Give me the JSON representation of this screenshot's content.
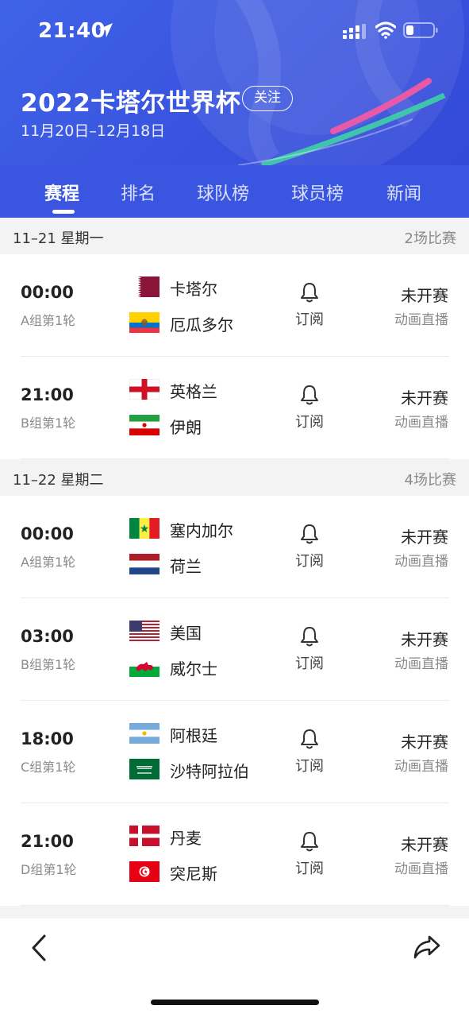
{
  "status_bar": {
    "time": "21:40"
  },
  "header": {
    "title": "2022卡塔尔世界杯",
    "follow_label": "关注",
    "dates": "11月20日–12月18日"
  },
  "tabs": [
    {
      "label": "赛程",
      "active": true
    },
    {
      "label": "排名",
      "active": false
    },
    {
      "label": "球队榜",
      "active": false
    },
    {
      "label": "球员榜",
      "active": false
    },
    {
      "label": "新闻",
      "active": false
    }
  ],
  "days": [
    {
      "date": "11–21 星期一",
      "count": "2场比赛",
      "matches": [
        {
          "time": "00:00",
          "group": "A组第1轮",
          "team1": "卡塔尔",
          "flag1": "qatar",
          "team2": "厄瓜多尔",
          "flag2": "ecuador",
          "subscribe": "订阅",
          "status": "未开赛",
          "stream": "动画直播"
        },
        {
          "time": "21:00",
          "group": "B组第1轮",
          "team1": "英格兰",
          "flag1": "england",
          "team2": "伊朗",
          "flag2": "iran",
          "subscribe": "订阅",
          "status": "未开赛",
          "stream": "动画直播"
        }
      ]
    },
    {
      "date": "11–22 星期二",
      "count": "4场比赛",
      "matches": [
        {
          "time": "00:00",
          "group": "A组第1轮",
          "team1": "塞内加尔",
          "flag1": "senegal",
          "team2": "荷兰",
          "flag2": "netherlands",
          "subscribe": "订阅",
          "status": "未开赛",
          "stream": "动画直播"
        },
        {
          "time": "03:00",
          "group": "B组第1轮",
          "team1": "美国",
          "flag1": "usa",
          "team2": "威尔士",
          "flag2": "wales",
          "subscribe": "订阅",
          "status": "未开赛",
          "stream": "动画直播"
        },
        {
          "time": "18:00",
          "group": "C组第1轮",
          "team1": "阿根廷",
          "flag1": "argentina",
          "team2": "沙特阿拉伯",
          "flag2": "saudi-arabia",
          "subscribe": "订阅",
          "status": "未开赛",
          "stream": "动画直播"
        },
        {
          "time": "21:00",
          "group": "D组第1轮",
          "team1": "丹麦",
          "flag1": "denmark",
          "team2": "突尼斯",
          "flag2": "tunisia",
          "subscribe": "订阅",
          "status": "未开赛",
          "stream": "动画直播"
        }
      ]
    }
  ],
  "icons": {
    "location": "location-arrow-icon",
    "signal": "cellular-signal-icon",
    "wifi": "wifi-icon",
    "battery": "battery-icon",
    "bell": "bell-icon",
    "back": "back-chevron-icon",
    "share": "share-icon"
  },
  "colors": {
    "header_blue": "#3a56e0",
    "accent_green": "#3fd0a6",
    "accent_pink": "#e85aa8"
  }
}
